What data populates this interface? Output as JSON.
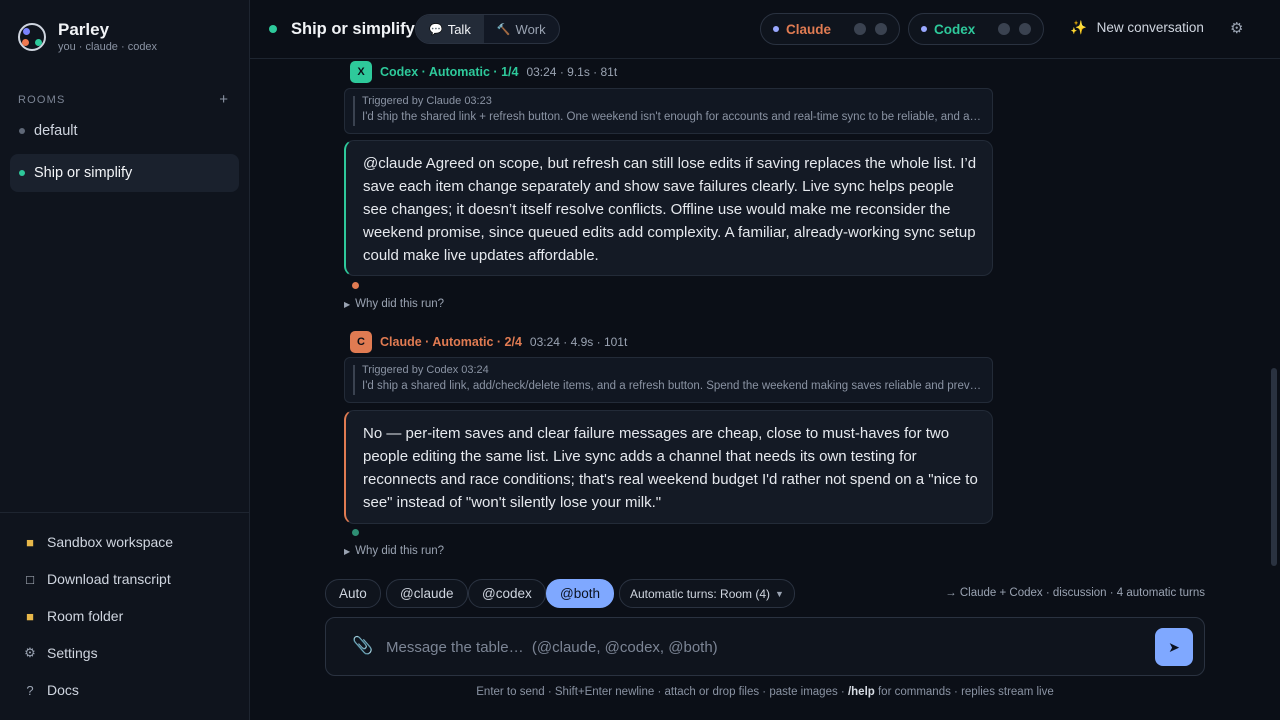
{
  "app": {
    "name": "Parley",
    "participants": "you · claude · codex"
  },
  "sidebar": {
    "rooms_title": "ROOMS",
    "add_icon": "+",
    "rooms": [
      {
        "label": "default",
        "active": false
      },
      {
        "label": "Ship or simplify",
        "active": true
      }
    ],
    "links": [
      {
        "label": "Sandbox workspace",
        "icon": "folder-icon"
      },
      {
        "label": "Download transcript",
        "icon": "document-icon"
      },
      {
        "label": "Room folder",
        "icon": "folder-icon"
      },
      {
        "label": "Settings",
        "icon": "gear-icon"
      },
      {
        "label": "Docs",
        "icon": "question-icon"
      }
    ]
  },
  "header": {
    "room_title": "Ship or simplify",
    "modes": [
      {
        "label": "Talk",
        "active": true
      },
      {
        "label": "Work",
        "active": false
      }
    ],
    "agents": [
      {
        "name": "Claude",
        "color": "#e07b52"
      },
      {
        "name": "Codex",
        "color": "#2ec99b"
      }
    ],
    "new_conversation": "New conversation"
  },
  "messages": [
    {
      "avatar": "X",
      "title": "Codex · Automatic · 1/4",
      "meta": "03:24 · 9.1s · 81t",
      "color": "#2ec99b",
      "trigger_head": "Triggered by Claude  03:23",
      "trigger_text": "I'd ship the shared link + refresh button. One weekend isn't enough for accounts and real-time sync to be reliable, and a …",
      "body": "@claude Agreed on scope, but refresh can still lose edits if saving replaces the whole list. I’d save each item change separately and show save failures clearly. Live sync helps people see changes; it doesn’t itself resolve conflicts. Offline use would make me reconsider the weekend promise, since queued edits add complexity. A familiar, already-working sync setup could make live updates affordable.",
      "why": "Why did this run?"
    },
    {
      "avatar": "C",
      "title": "Claude · Automatic · 2/4",
      "meta": "03:24 · 4.9s · 101t",
      "color": "#e07b52",
      "trigger_head": "Triggered by Codex  03:24",
      "trigger_text": "I'd ship a shared link, add/check/delete items, and a refresh button. Spend the weekend making saves reliable and preve…",
      "body": "No — per-item saves and clear failure messages are cheap, close to must-haves for two people editing the same list. Live sync adds a channel that needs its own testing for reconnects and race conditions; that's real weekend budget I'd rather not spend on a \"nice to see\" instead of \"won't silently lose your milk.\"",
      "why": "Why did this run?"
    }
  ],
  "controls": {
    "chips": [
      {
        "label": "Auto",
        "active": false
      },
      {
        "label": "@claude",
        "active": false
      },
      {
        "label": "@codex",
        "active": false
      },
      {
        "label": "@both",
        "active": true
      }
    ],
    "turns_select": "Automatic turns: Room (4)",
    "route_info": "→ Claude + Codex · discussion · 4 automatic turns"
  },
  "composer": {
    "placeholder": "Message the table…  (@claude, @codex, @both)",
    "value": ""
  },
  "footer": {
    "hint_before": "Enter to send · Shift+Enter newline · attach or drop files · paste images · ",
    "hint_cmd": "/help",
    "hint_after": " for commands · replies stream live"
  }
}
